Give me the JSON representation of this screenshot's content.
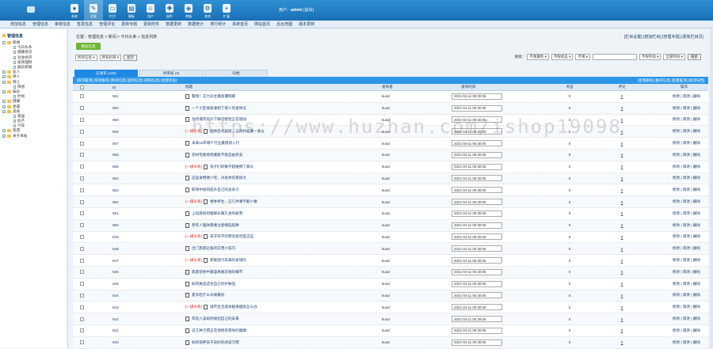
{
  "topnav": [
    {
      "label": "系统",
      "icon": "user-icon"
    },
    {
      "label": "信息",
      "icon": "edit-icon",
      "active": true
    },
    {
      "label": "栏目",
      "icon": "folder-icon"
    },
    {
      "label": "模板",
      "icon": "template-icon"
    },
    {
      "label": "用户",
      "icon": "person-icon"
    },
    {
      "label": "插件",
      "icon": "plugin-icon"
    },
    {
      "label": "商城",
      "icon": "shop-icon"
    },
    {
      "label": "其他",
      "icon": "gear-icon"
    },
    {
      "label": "扩展",
      "icon": "plus-icon"
    }
  ],
  "user": {
    "prefix": "用户：",
    "name": "admin",
    "logout": "[退出]"
  },
  "menubar": [
    "增加信息",
    "管理信息",
    "审核信息",
    "签发信息",
    "管理评论",
    "更新专题",
    "更新附件",
    "数据更新",
    "数据统计",
    "排行统计",
    "系统首页",
    "网站首页",
    "后台地图",
    "版本更新"
  ],
  "sidebar": {
    "title": "管理信息",
    "items": [
      {
        "label": "新闻",
        "type": "folder-open"
      },
      {
        "label": "今日头条",
        "type": "page"
      },
      {
        "label": "健康资讯",
        "type": "page"
      },
      {
        "label": "社会经济",
        "type": "page"
      },
      {
        "label": "投资理财",
        "type": "page"
      },
      {
        "label": "娱乐新闻",
        "type": "page"
      },
      {
        "label": "女人",
        "type": "folder"
      },
      {
        "label": "男人",
        "type": "folder"
      },
      {
        "label": "育儿",
        "type": "folder"
      },
      {
        "label": "情感",
        "type": "page"
      },
      {
        "label": "娱乐",
        "type": "folder"
      },
      {
        "label": "时尚",
        "type": "page"
      },
      {
        "label": "健康",
        "type": "folder"
      },
      {
        "label": "星座",
        "type": "folder"
      },
      {
        "label": "美食",
        "type": "folder"
      },
      {
        "label": "家居",
        "type": "page"
      },
      {
        "label": "房产",
        "type": "page"
      },
      {
        "label": "汽车",
        "type": "page"
      },
      {
        "label": "旅游",
        "type": "folder"
      },
      {
        "label": "关于本站",
        "type": "folder"
      }
    ]
  },
  "breadcrumb": "位置：管理信息 > 新闻 > 今日头条 > 信息列表",
  "toplinks": "[栏目设置] [增加栏目] [管理专题] [更新栏目页]",
  "add_button": "增加信息",
  "filter": {
    "select1": "所有信息",
    "select2": "所有栏目",
    "show_button": "显示",
    "search_label": "搜索：",
    "select3": "不限属性",
    "select4": "不限状态",
    "select5": "不限",
    "select6": "不限字段",
    "select7": "全部时间",
    "search_button": "搜索"
  },
  "tabs": [
    {
      "label": "已发布 (100)",
      "active": true
    },
    {
      "label": "待审核 (0)"
    },
    {
      "label": "归档"
    }
  ],
  "actionbar": {
    "left": "[取消置顶] [取消推荐] [移动信息] [复制信息] [审核信息] [批量签发]",
    "right": "[批量删除] [推荐信息] [批量置顶] [取消归档]"
  },
  "table": {
    "headers": [
      "ID",
      "标题",
      "发布者",
      "发布时间",
      "点击",
      "评论",
      "操作"
    ],
    "rows": [
      {
        "id": "861",
        "tag": "",
        "title": "警惕！实力派主播竟遭网暴",
        "author": "kuwz",
        "time": "2021-04-11 00:30:06",
        "views": "0",
        "comments": "0"
      },
      {
        "id": "860",
        "tag": "",
        "title": "一个小区保安收到了惊人的退休信",
        "author": "kuwz",
        "time": "2021-04-11 00:30:06",
        "views": "0",
        "comments": "0"
      },
      {
        "id": "859",
        "tag": "",
        "title": "为何城市房价下跌可能性正在增加",
        "author": "kuwz",
        "time": "2021-04-11 00:30:06",
        "views": "0",
        "comments": "0"
      },
      {
        "id": "858",
        "tag": "[一级头条]",
        "title": "退休后才知道，工资并非唯一收入",
        "author": "kuwz",
        "time": "2021-04-11 00:30:06",
        "views": "0",
        "comments": "0"
      },
      {
        "id": "857",
        "tag": "",
        "title": "未来10年哪个行业最值得入行",
        "author": "kuwz",
        "time": "2021-04-11 00:30:06",
        "views": "0",
        "comments": "0"
      },
      {
        "id": "856",
        "tag": "",
        "title": "农村宅基地到底能不能自由买卖",
        "author": "kuwz",
        "time": "2021-04-11 00:30:06",
        "views": "0",
        "comments": "0"
      },
      {
        "id": "855",
        "tag": "[一级头条]",
        "title": "孩子们的数学题难倒了家长",
        "author": "kuwz",
        "time": "2021-04-11 00:30:06",
        "views": "0",
        "comments": "0"
      },
      {
        "id": "854",
        "tag": "",
        "title": "这些食物要少吃，对身体伤害很大",
        "author": "kuwz",
        "time": "2021-04-11 00:30:06",
        "views": "0",
        "comments": "0"
      },
      {
        "id": "853",
        "tag": "",
        "title": "职场中如何提升自己的竞争力",
        "author": "kuwz",
        "time": "2021-04-11 00:30:06",
        "views": "0",
        "comments": "0"
      },
      {
        "id": "852",
        "tag": "[一级头条]",
        "title": "春季养生，这几件事不能少做",
        "author": "kuwz",
        "time": "2021-04-11 00:30:06",
        "views": "0",
        "comments": "0"
      },
      {
        "id": "851",
        "tag": "",
        "title": "上班族如何缓解长期久坐的疲劳",
        "author": "kuwz",
        "time": "2021-04-11 00:30:06",
        "views": "0",
        "comments": "0"
      },
      {
        "id": "850",
        "tag": "",
        "title": "老年人理财需要注意哪些陷阱",
        "author": "kuwz",
        "time": "2021-04-11 00:30:06",
        "views": "0",
        "comments": "0"
      },
      {
        "id": "849",
        "tag": "[一级头条]",
        "title": "孩子厌学的原因竟然是这些",
        "author": "kuwz",
        "time": "2021-04-11 00:30:06",
        "views": "0",
        "comments": "0"
      },
      {
        "id": "848",
        "tag": "",
        "title": "出门旅游必备的实用小技巧",
        "author": "kuwz",
        "time": "2021-04-11 00:30:06",
        "views": "0",
        "comments": "0"
      },
      {
        "id": "847",
        "tag": "[一级头条]",
        "title": "新能源汽车真的省钱吗",
        "author": "kuwz",
        "time": "2021-04-11 00:30:06",
        "views": "0",
        "comments": "0"
      },
      {
        "id": "846",
        "tag": "",
        "title": "家庭装修中最容易被忽视的细节",
        "author": "kuwz",
        "time": "2021-04-11 00:30:06",
        "views": "0",
        "comments": "0"
      },
      {
        "id": "845",
        "tag": "",
        "title": "如何挑选适合自己的护肤品",
        "author": "kuwz",
        "time": "2021-04-11 00:30:06",
        "views": "0",
        "comments": "0"
      },
      {
        "id": "844",
        "tag": "",
        "title": "夏天吃什么水果最好",
        "author": "kuwz",
        "time": "2021-04-11 00:30:06",
        "views": "0",
        "comments": "0"
      },
      {
        "id": "843",
        "tag": "[一级头条]",
        "title": "城市生活成本越来越高怎么办",
        "author": "kuwz",
        "time": "2021-04-11 00:30:06",
        "views": "0",
        "comments": "0"
      },
      {
        "id": "842",
        "tag": "",
        "title": "年轻人该如何规划自己的未来",
        "author": "kuwz",
        "time": "2021-04-11 00:30:06",
        "views": "0",
        "comments": "0"
      },
      {
        "id": "841",
        "tag": "",
        "title": "这几种习惯正在悄悄伤害你的健康",
        "author": "kuwz",
        "time": "2021-04-11 00:30:06",
        "views": "0",
        "comments": "0"
      },
      {
        "id": "840",
        "tag": "",
        "title": "如何培养孩子良好的阅读习惯",
        "author": "kuwz",
        "time": "2021-04-11 00:30:06",
        "views": "0",
        "comments": "0"
      }
    ],
    "ops": [
      "修改",
      "简改",
      "删除"
    ]
  },
  "watermark": "https://www.huzhan.com/ishop19098",
  "colors": {
    "accent": "#1e88e5",
    "topbar": "#2f8fd2",
    "add_button": "#6fb53a",
    "tag": "#d9261c"
  }
}
